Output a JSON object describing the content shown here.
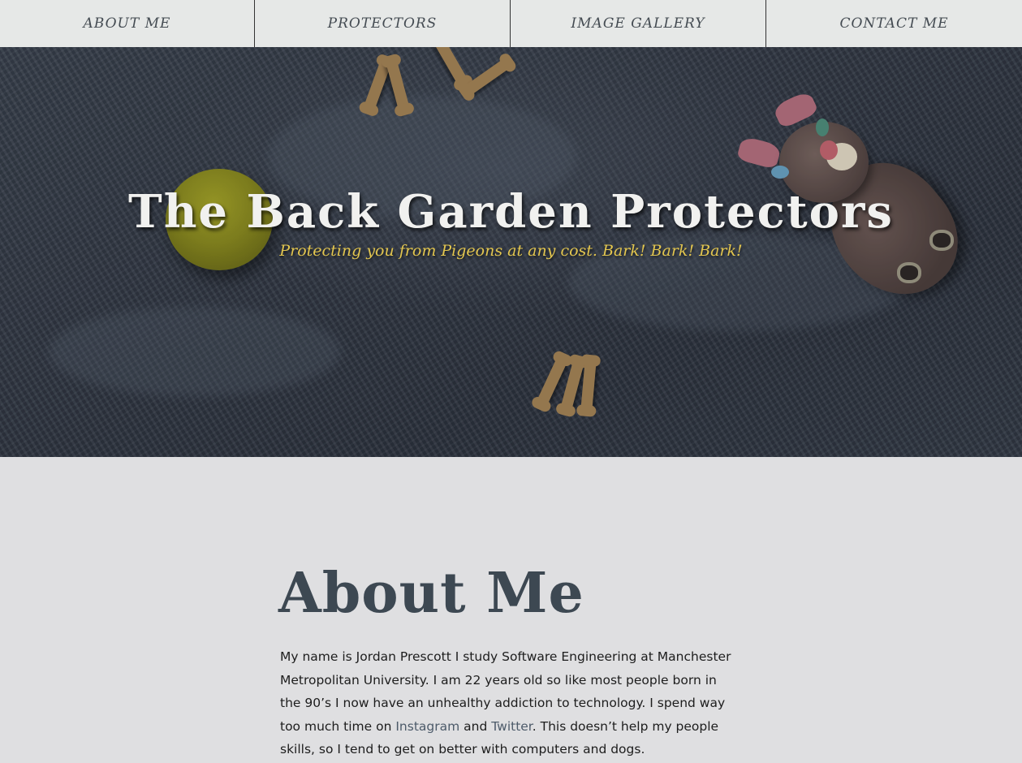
{
  "nav": {
    "items": [
      {
        "label": "ABOUT ME"
      },
      {
        "label": "PROTECTORS"
      },
      {
        "label": "IMAGE GALLERY"
      },
      {
        "label": "CONTACT ME"
      }
    ]
  },
  "hero": {
    "title": "The Back Garden Protectors",
    "subtitle": "Protecting you from Pigeons at any cost. Bark! Bark! Bark!"
  },
  "about": {
    "heading": "About Me",
    "text_before": "My name is Jordan Prescott I study Software Engineering at Manchester Metropolitan University. I am 22 years old so like most people born in the 90’s I now have an unhealthy addiction to technology. I spend way too much time on ",
    "link_instagram": "Instagram",
    "text_middle": " and ",
    "link_twitter": "Twitter",
    "text_after": ". This doesn’t help my people skills, so I tend to get on better with computers and dogs."
  },
  "colors": {
    "nav_background": "#e6e8e7",
    "nav_text": "#444b52",
    "hero_title": "#f1f1ef",
    "hero_subtitle": "#e3c64f",
    "about_heading": "#3d4852",
    "link": "#4d5b6a",
    "page_background": "#dfdfe1"
  }
}
